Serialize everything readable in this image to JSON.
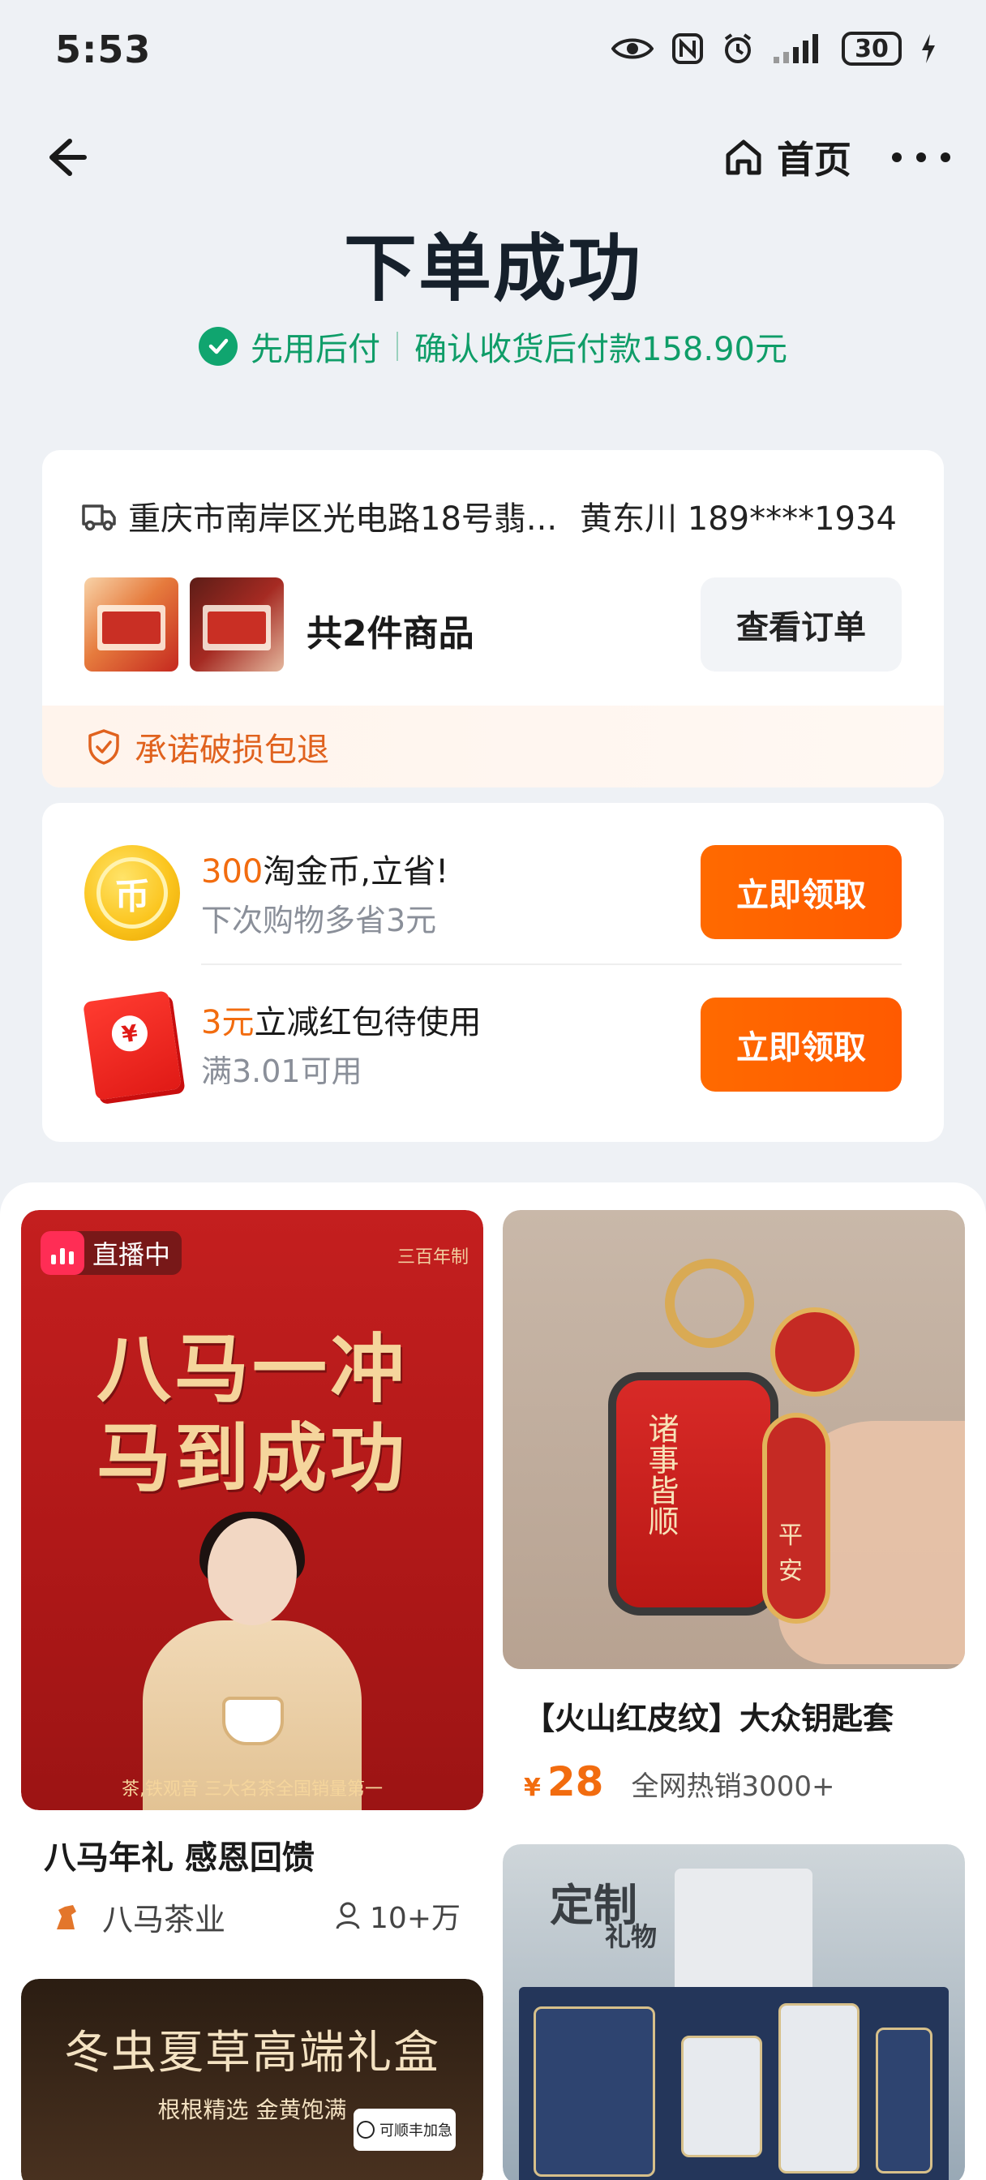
{
  "status_bar": {
    "time": "5:53",
    "battery": "30"
  },
  "nav": {
    "home_label": "首页"
  },
  "header": {
    "title": "下单成功",
    "pay_method": "先用后付",
    "pay_note": "确认收货后付款158.90元",
    "accent_color": "#10a56f"
  },
  "order": {
    "address": "重庆市南岸区光电路18号翡...",
    "recipient": "黄东川 189****1934",
    "item_count_label": "共2件商品",
    "view_order_label": "查看订单",
    "guarantee_label": "承诺破损包退"
  },
  "coupons": [
    {
      "highlight": "300",
      "title": "淘金币,立省!",
      "subtitle": "下次购物多省3元",
      "button": "立即领取",
      "icon": "gold-coin-icon",
      "icon_glyph": "币"
    },
    {
      "highlight": "3元",
      "title": "立减红包待使用",
      "subtitle": "满3.01可用",
      "button": "立即领取",
      "icon": "red-packet-icon",
      "icon_glyph": "¥"
    }
  ],
  "feed": {
    "live_card": {
      "badge": "直播中",
      "poster_line1": "八马一冲",
      "poster_line2": "马到成功",
      "poster_brand": "三百年制",
      "poster_tagline": "茶,铁观音 三大名茶全国销量第一",
      "title": "八马年礼 感恩回馈",
      "shop_name": "八马茶业",
      "fans": "10+万"
    },
    "key_card": {
      "title": "【火山红皮纹】大众钥匙套",
      "price_symbol": "¥",
      "price": "28",
      "sales_tag": "全网热销3000+",
      "keyholder_text": "诸事皆顺",
      "tag_text": "平安"
    },
    "cordyceps_card": {
      "headline": "冬虫夏草高端礼盒",
      "subline": "根根精选 金黄饱满",
      "sf_tag": "可顺丰加急"
    },
    "gift_card": {
      "stamp_main": "定制",
      "stamp_sub": "礼物"
    }
  },
  "colors": {
    "orange": "#ff6a00",
    "green": "#10a56f",
    "background": "#eef1f5"
  }
}
